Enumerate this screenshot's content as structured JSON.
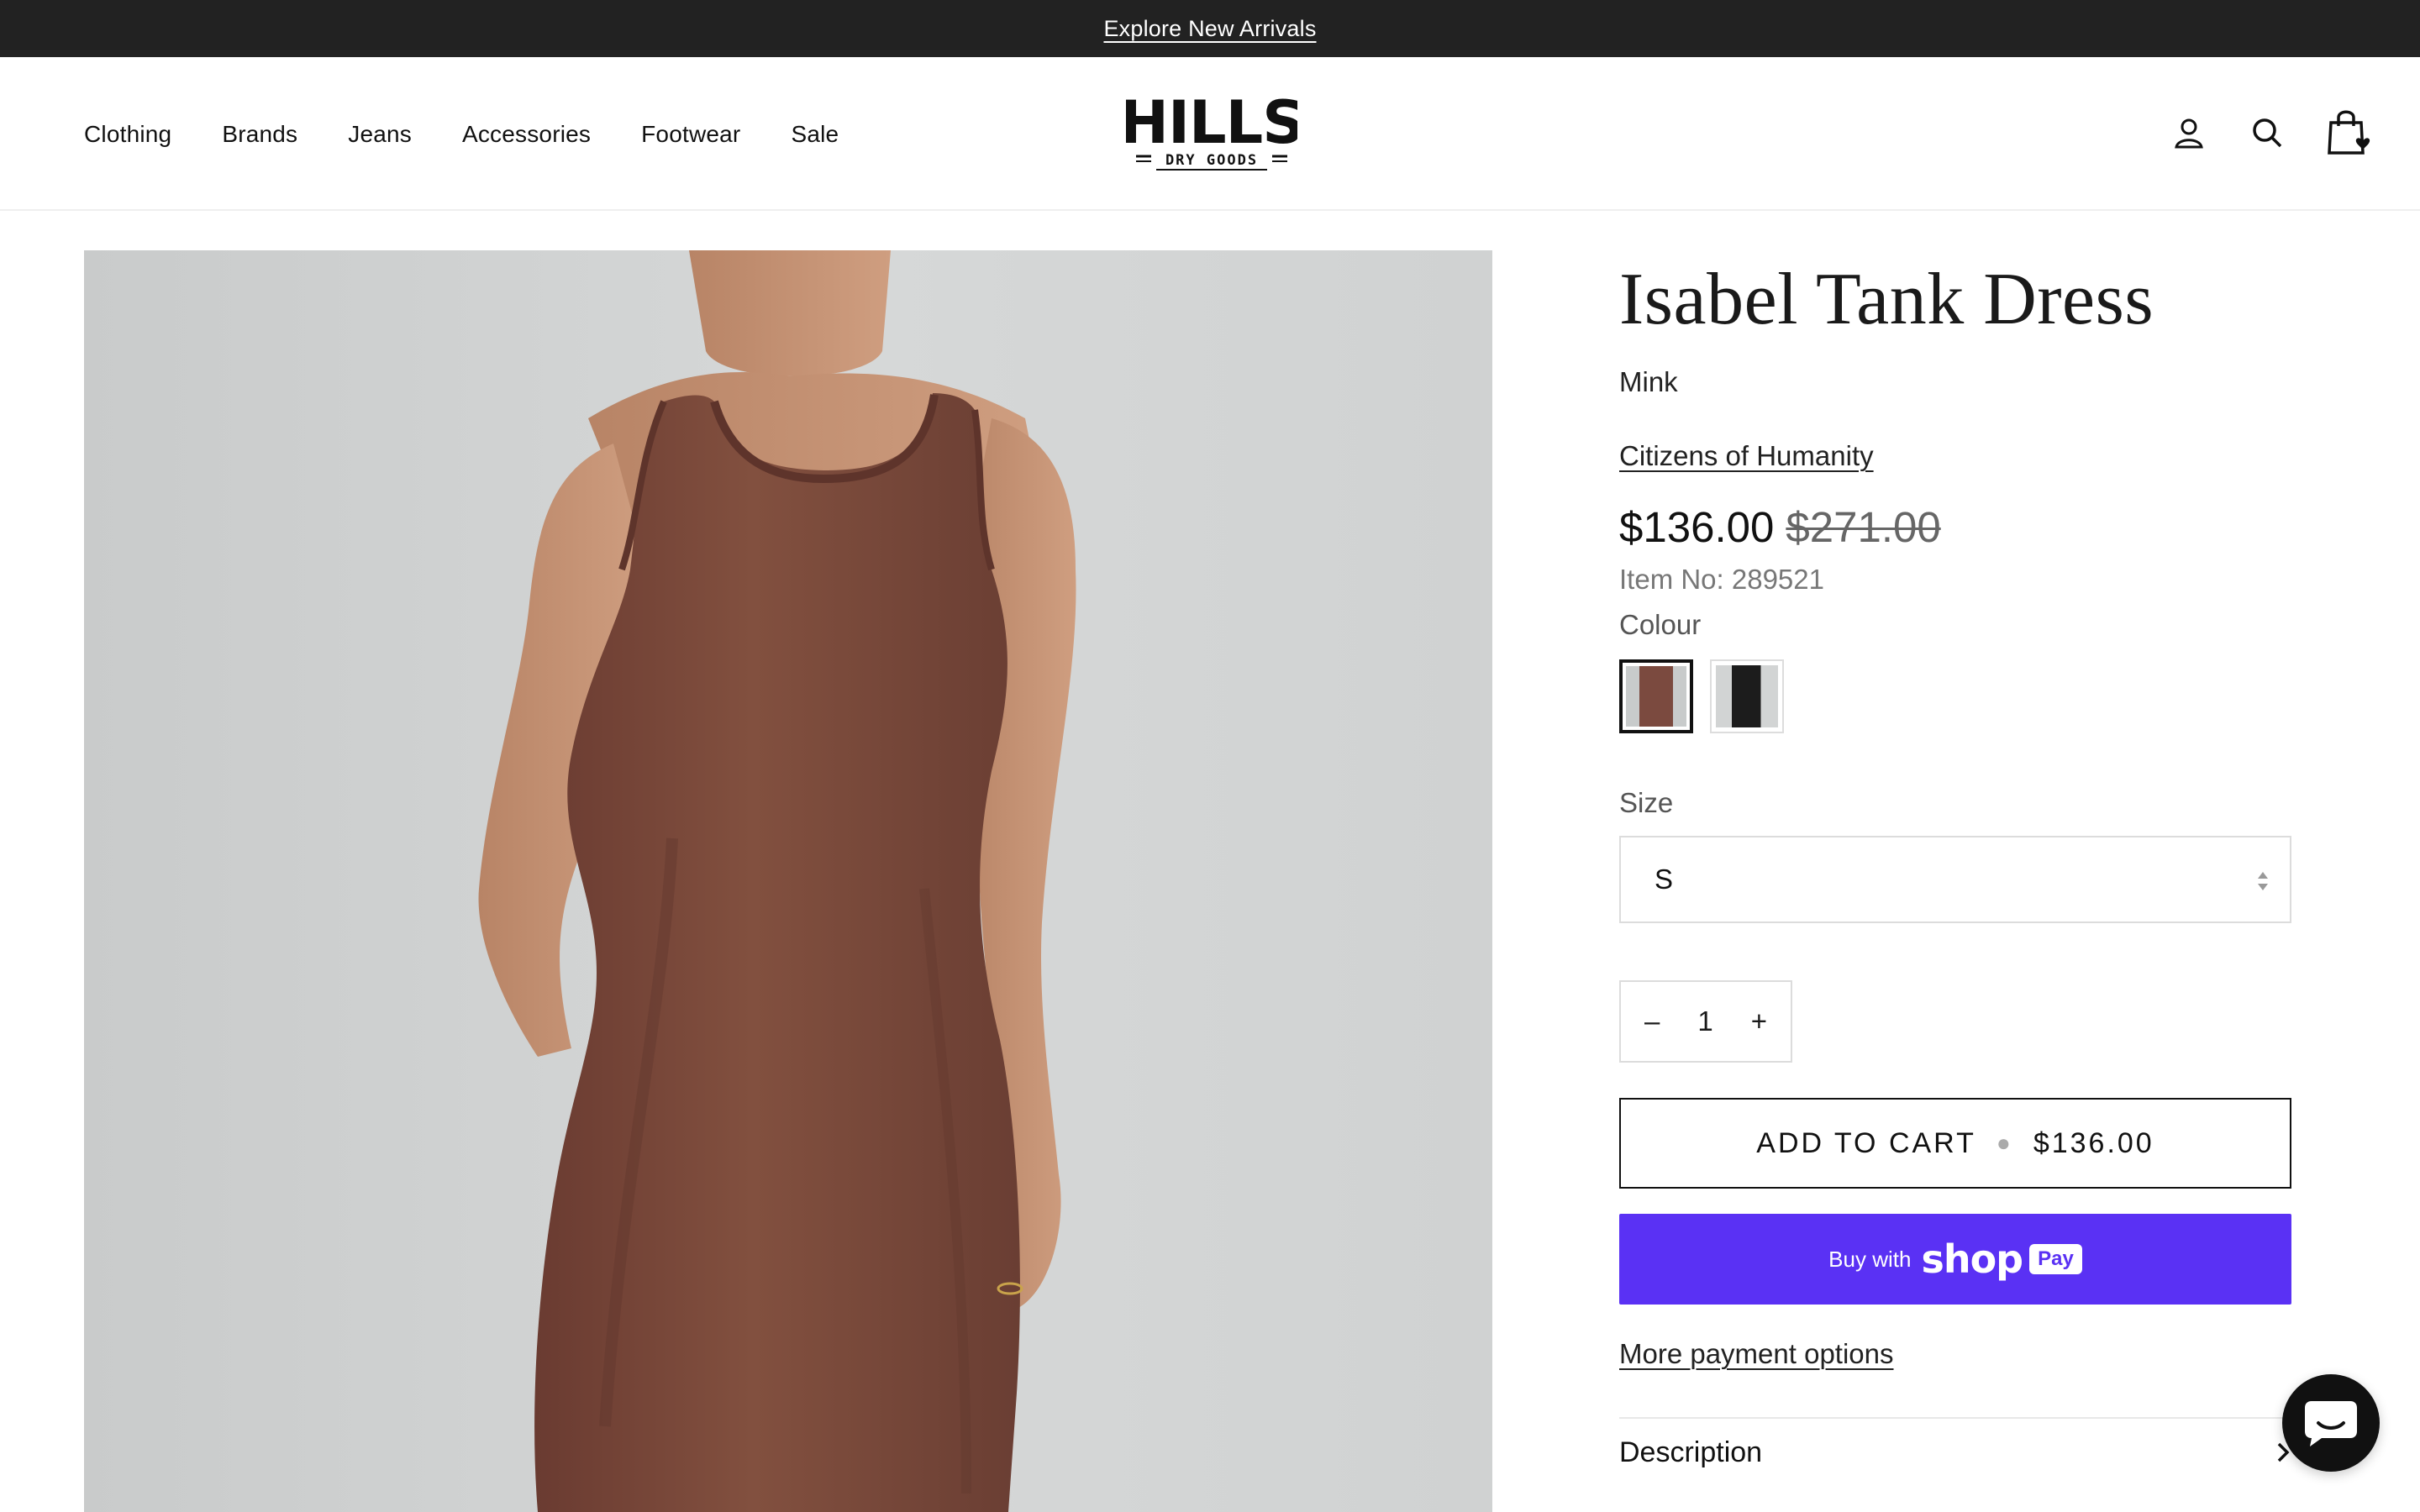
{
  "announcement": {
    "text": "Explore New Arrivals"
  },
  "nav": {
    "items": [
      "Clothing",
      "Brands",
      "Jeans",
      "Accessories",
      "Footwear",
      "Sale"
    ]
  },
  "logo": {
    "line1": "HILLS",
    "line2": "DRY GOODS"
  },
  "header_icons": [
    "account-icon",
    "search-icon",
    "cart-icon"
  ],
  "product": {
    "title": "Isabel Tank Dress",
    "variant": "Mink",
    "vendor": "Citizens of Humanity",
    "price": "$136.00",
    "compare_price": "$271.00",
    "sku": "Item No: 289521",
    "colour_label": "Colour",
    "colours": [
      {
        "name": "mink",
        "color": "#7b4a3f",
        "selected": true
      },
      {
        "name": "black",
        "color": "#1c1c1c",
        "selected": false
      }
    ],
    "size_label": "Size",
    "size_value": "S",
    "quantity": "1",
    "qty_minus": "–",
    "qty_plus": "+",
    "add_to_cart": "ADD TO CART",
    "add_to_cart_price": "$136.00",
    "shoppay": {
      "buy_with": "Buy with",
      "shop": "shop",
      "pay": "Pay"
    },
    "more_payment": "More payment options",
    "description_label": "Description"
  },
  "colors": {
    "announcement_bg": "#222222",
    "shoppay_bg": "#5a31f4",
    "image_bg": "#cfd1d1",
    "dress": "#7b4a3f"
  }
}
